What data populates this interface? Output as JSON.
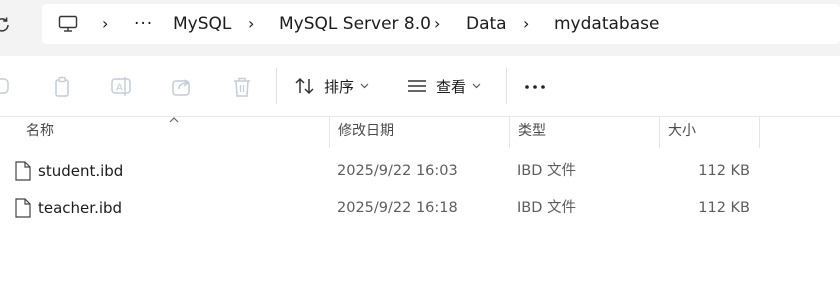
{
  "breadcrumb": {
    "items": [
      "MySQL",
      "MySQL Server 8.0",
      "Data",
      "mydatabase"
    ],
    "more_label": "···",
    "separator": "›"
  },
  "toolbar": {
    "sort_label": "排序",
    "view_label": "查看",
    "more_label": "···"
  },
  "columns": {
    "name": "名称",
    "modified": "修改日期",
    "type": "类型",
    "size": "大小"
  },
  "files": [
    {
      "name": "student.ibd",
      "modified": "2025/9/22 16:03",
      "type": "IBD 文件",
      "size": "112 KB"
    },
    {
      "name": "teacher.ibd",
      "modified": "2025/9/22 16:18",
      "type": "IBD 文件",
      "size": "112 KB"
    }
  ],
  "colors": {
    "topbar_bg": "#f3f3f3",
    "disabled_icon": "#c4ccd6",
    "text_secondary": "#5d5d5d"
  }
}
